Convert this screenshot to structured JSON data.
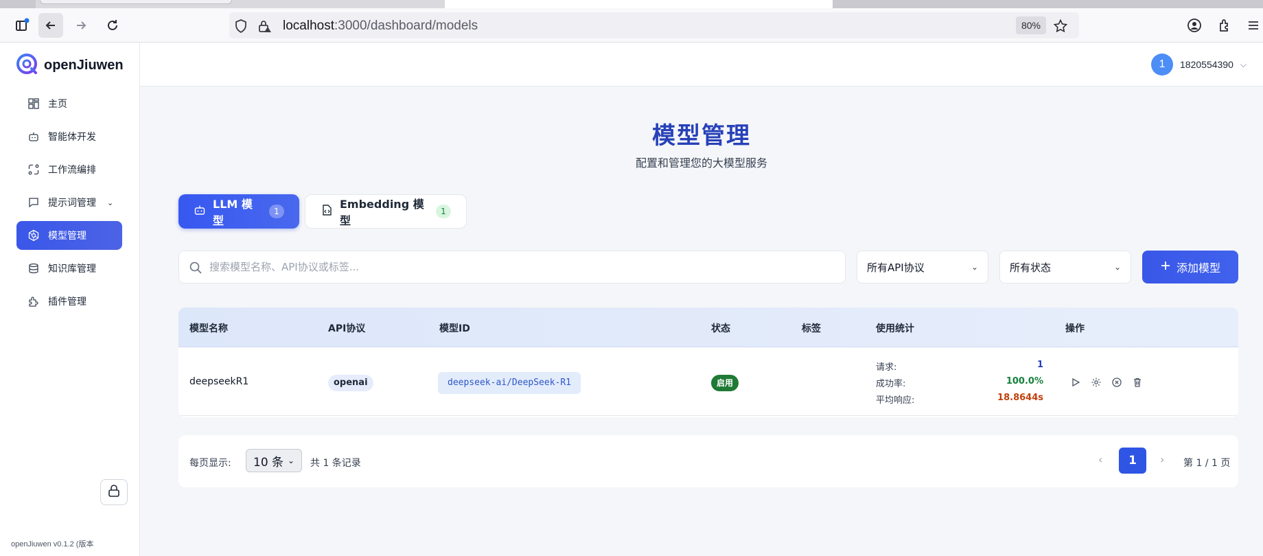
{
  "browser": {
    "url_host": "localhost",
    "url_path": ":3000/dashboard/models",
    "zoom": "80%"
  },
  "sidebar": {
    "brand": "openJiuwen",
    "items": [
      {
        "label": "主页",
        "icon": "grid-icon"
      },
      {
        "label": "智能体开发",
        "icon": "robot-icon"
      },
      {
        "label": "工作流编排",
        "icon": "workflow-icon"
      },
      {
        "label": "提示词管理",
        "icon": "chat-icon"
      },
      {
        "label": "模型管理",
        "icon": "model-icon"
      },
      {
        "label": "知识库管理",
        "icon": "database-icon"
      },
      {
        "label": "插件管理",
        "icon": "plugin-icon"
      }
    ],
    "version": "openJiuwen v0.1.2 (版本"
  },
  "header": {
    "avatar": "1",
    "username": "1820554390"
  },
  "main": {
    "title": "模型管理",
    "subtitle": "配置和管理您的大模型服务",
    "tabs": [
      {
        "label": "LLM 模型",
        "count": "1"
      },
      {
        "label": "Embedding 模型",
        "count": "1"
      }
    ],
    "search_placeholder": "搜索模型名称、API协议或标签...",
    "filter_api": "所有API协议",
    "filter_status": "所有状态",
    "add_button": "添加模型"
  },
  "table": {
    "columns": [
      "模型名称",
      "API协议",
      "模型ID",
      "状态",
      "标签",
      "使用统计",
      "操作"
    ],
    "rows": [
      {
        "name": "deepseekR1",
        "api": "openai",
        "model_id": "deepseek-ai/DeepSeek-R1",
        "status": "启用",
        "stats": {
          "requests_label": "请求:",
          "requests_value": "1",
          "success_label": "成功率:",
          "success_value": "100.0%",
          "latency_label": "平均响应:",
          "latency_value": "18.8644s"
        }
      }
    ]
  },
  "pagination": {
    "per_page_label": "每页显示:",
    "per_page_value": "10 条",
    "total": "共 1 条记录",
    "current": "1",
    "page_info": "第 1 / 1 页"
  },
  "colors": {
    "accent": "#3a57e8",
    "title": "#2741b8",
    "success": "#15803d",
    "latency": "#c2410c"
  }
}
